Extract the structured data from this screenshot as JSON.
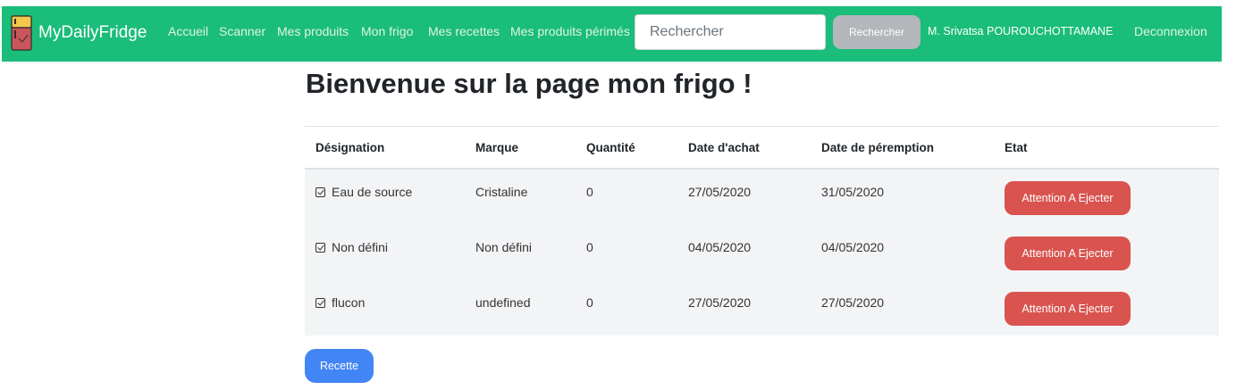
{
  "navbar": {
    "brand": "MyDailyFridge",
    "links": [
      "Accueil",
      "Scanner",
      "Mes produits",
      "Mon frigo",
      "Mes recettes",
      "Mes produits périmés"
    ],
    "search_placeholder": "Rechercher",
    "search_button": "Rechercher",
    "user": "M. Srivatsa POUROUCHOTTAMANE",
    "logout": "Deconnexion",
    "background_color": "#1abd7a"
  },
  "page": {
    "title": "Bienvenue sur la page mon frigo !"
  },
  "table": {
    "headers": [
      "Désignation",
      "Marque",
      "Quantité",
      "Date d'achat",
      "Date de péremption",
      "Etat"
    ],
    "rows": [
      {
        "designation": "Eau de source",
        "marque": "Cristaline",
        "quantite": "0",
        "date_achat": "27/05/2020",
        "date_peremption": "31/05/2020",
        "etat": "Attention A Ejecter"
      },
      {
        "designation": "Non défini",
        "marque": "Non défini",
        "quantite": "0",
        "date_achat": "04/05/2020",
        "date_peremption": "04/05/2020",
        "etat": "Attention A Ejecter"
      },
      {
        "designation": "flucon",
        "marque": "undefined",
        "quantite": "0",
        "date_achat": "27/05/2020",
        "date_peremption": "27/05/2020",
        "etat": "Attention A Ejecter"
      }
    ],
    "status_color": "#d9534f"
  },
  "actions": {
    "recipe_button": "Recette",
    "recipe_color": "#4285f4"
  },
  "icons": {
    "brand": "fridge-icon",
    "row_check": "checkbox-icon"
  }
}
